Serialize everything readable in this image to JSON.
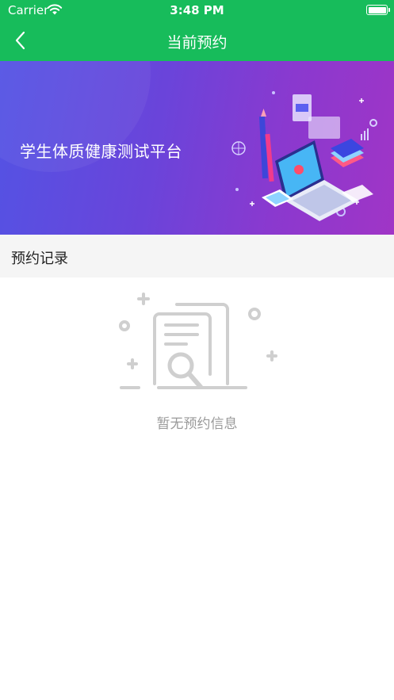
{
  "status_bar": {
    "carrier": "Carrier",
    "time": "3:48 PM"
  },
  "nav": {
    "title": "当前预约",
    "back_icon": "chevron-left-icon"
  },
  "banner": {
    "title": "学生体质健康测试平台"
  },
  "section": {
    "title": "预约记录"
  },
  "empty_state": {
    "message": "暂无预约信息",
    "icon": "document-search-icon"
  },
  "colors": {
    "primary": "#17bc5b",
    "banner_start": "#5353e4",
    "banner_end": "#a035c6",
    "section_bg": "#f5f5f5",
    "muted_text": "#9a9a9a"
  }
}
